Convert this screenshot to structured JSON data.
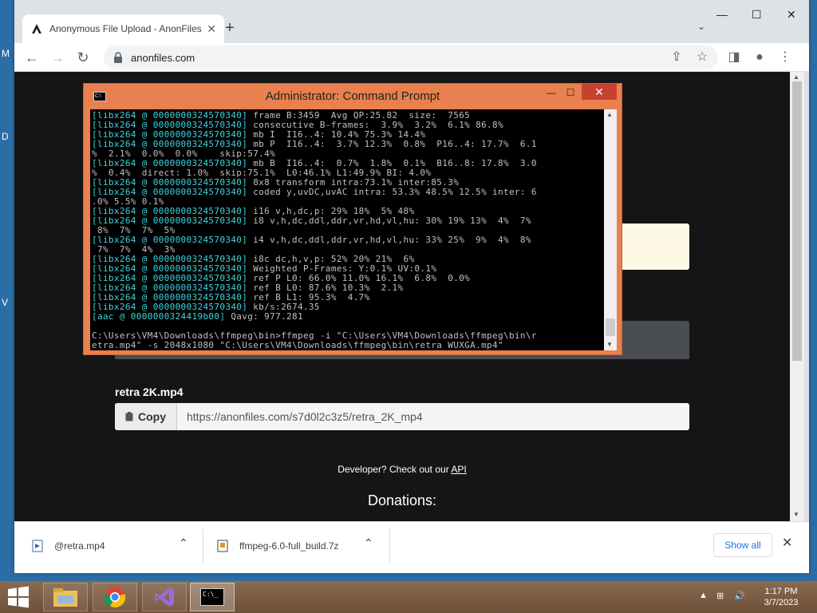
{
  "desktop": {
    "edge_letters": [
      "M",
      "D",
      "V"
    ]
  },
  "browser": {
    "tab": {
      "title": "Anonymous File Upload - AnonFiles",
      "close": "✕"
    },
    "new_tab": "+",
    "tab_search": "⌄",
    "window_controls": {
      "minimize": "—",
      "maximize": "☐",
      "close": "✕"
    },
    "nav": {
      "back": "←",
      "forward": "→",
      "reload": "↻"
    },
    "address": "anonfiles.com",
    "toolbar_icons": {
      "share": "⇪",
      "bookmark": "☆",
      "sidepanel": "◨",
      "profile": "●",
      "menu": "⋮"
    }
  },
  "page": {
    "file_name": "retra 2K.mp4",
    "copy_label": "Copy",
    "link": "https://anonfiles.com/s7d0l2c3z5/retra_2K_mp4",
    "developer_text": "Developer? Check out our ",
    "developer_link": "API",
    "donations": "Donations:"
  },
  "downloads": {
    "items": [
      {
        "name": "@retra.mp4"
      },
      {
        "name": "ffmpeg-6.0-full_build.7z"
      }
    ],
    "show_all": "Show all",
    "close": "✕"
  },
  "cmd": {
    "title": "Administrator:  Command Prompt",
    "icon_text": "C:\\",
    "buttons": {
      "minimize": "—",
      "maximize": "☐",
      "close": "✕"
    },
    "lines": [
      {
        "tag": "[libx264 @ 0000000324570340]",
        "text": " frame B:3459  Avg QP:25.82  size:  7565"
      },
      {
        "tag": "[libx264 @ 0000000324570340]",
        "text": " consecutive B-frames:  3.9%  3.2%  6.1% 86.8%"
      },
      {
        "tag": "[libx264 @ 0000000324570340]",
        "text": " mb I  I16..4: 10.4% 75.3% 14.4%"
      },
      {
        "tag": "[libx264 @ 0000000324570340]",
        "text": " mb P  I16..4:  3.7% 12.3%  0.8%  P16..4: 17.7%  6.1"
      },
      {
        "tag": "",
        "text": "%  2.1%  0.0%  0.0%    skip:57.4%"
      },
      {
        "tag": "[libx264 @ 0000000324570340]",
        "text": " mb B  I16..4:  0.7%  1.8%  0.1%  B16..8: 17.8%  3.0"
      },
      {
        "tag": "",
        "text": "%  0.4%  direct: 1.0%  skip:75.1%  L0:46.1% L1:49.9% BI: 4.0%"
      },
      {
        "tag": "[libx264 @ 0000000324570340]",
        "text": " 8x8 transform intra:73.1% inter:85.3%"
      },
      {
        "tag": "[libx264 @ 0000000324570340]",
        "text": " coded y,uvDC,uvAC intra: 53.3% 48.5% 12.5% inter: 6"
      },
      {
        "tag": "",
        "text": ".0% 5.5% 0.1%"
      },
      {
        "tag": "[libx264 @ 0000000324570340]",
        "text": " i16 v,h,dc,p: 29% 18%  5% 48%"
      },
      {
        "tag": "[libx264 @ 0000000324570340]",
        "text": " i8 v,h,dc,ddl,ddr,vr,hd,vl,hu: 30% 19% 13%  4%  7%"
      },
      {
        "tag": "",
        "text": " 8%  7%  7%  5%"
      },
      {
        "tag": "[libx264 @ 0000000324570340]",
        "text": " i4 v,h,dc,ddl,ddr,vr,hd,vl,hu: 33% 25%  9%  4%  8%"
      },
      {
        "tag": "",
        "text": " 7%  7%  4%  3%"
      },
      {
        "tag": "[libx264 @ 0000000324570340]",
        "text": " i8c dc,h,v,p: 52% 20% 21%  6%"
      },
      {
        "tag": "[libx264 @ 0000000324570340]",
        "text": " Weighted P-Frames: Y:0.1% UV:0.1%"
      },
      {
        "tag": "[libx264 @ 0000000324570340]",
        "text": " ref P L0: 66.0% 11.0% 16.1%  6.8%  0.0%"
      },
      {
        "tag": "[libx264 @ 0000000324570340]",
        "text": " ref B L0: 87.6% 10.3%  2.1%"
      },
      {
        "tag": "[libx264 @ 0000000324570340]",
        "text": " ref B L1: 95.3%  4.7%"
      },
      {
        "tag": "[libx264 @ 0000000324570340]",
        "text": " kb/s:2674.35"
      },
      {
        "tag": "[aac @ 0000000324419b00]",
        "text": " Qavg: 977.281"
      },
      {
        "tag": "",
        "text": ""
      },
      {
        "tag": "",
        "text": "C:\\Users\\VM4\\Downloads\\ffmpeg\\bin>ffmpeg -i \"C:\\Users\\VM4\\Downloads\\ffmpeg\\bin\\r"
      },
      {
        "tag": "",
        "text": "etra.mp4\" -s 2048x1080 \"C:\\Users\\VM4\\Downloads\\ffmpeg\\bin\\retra WUXGA.mp4\""
      }
    ]
  },
  "taskbar": {
    "clock_time": "1:17 PM",
    "clock_date": "3/7/2023",
    "tray": {
      "arrow": "▲",
      "network": "⊞",
      "volume": "🔊"
    },
    "cmd_icon_text": "C:\\_"
  }
}
